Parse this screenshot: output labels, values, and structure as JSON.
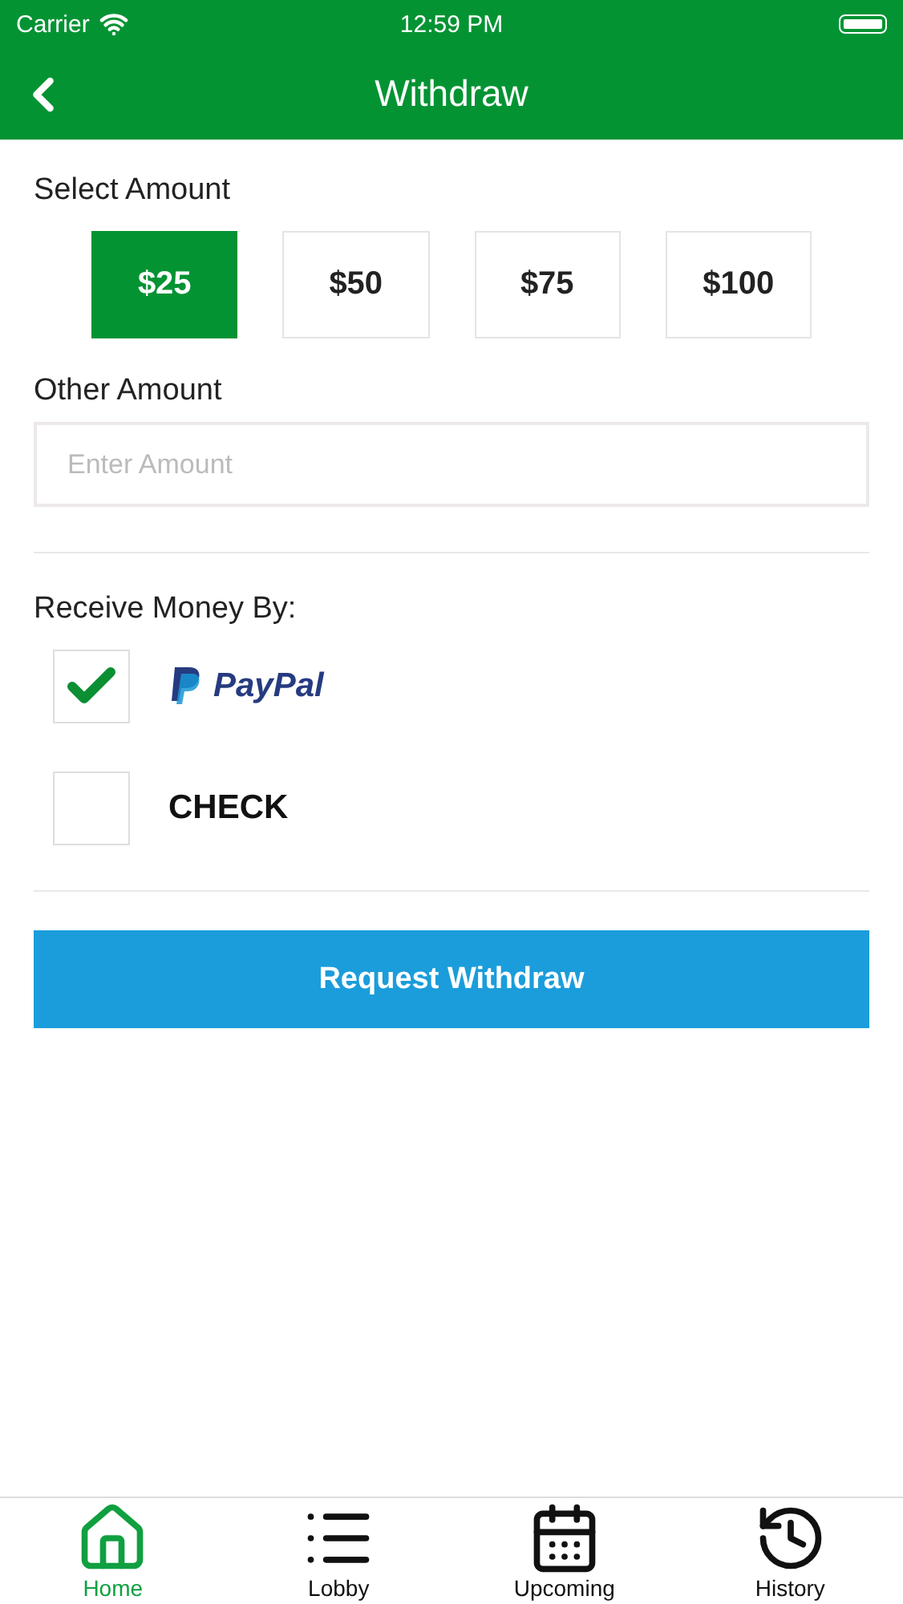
{
  "status_bar": {
    "carrier": "Carrier",
    "time": "12:59 PM"
  },
  "nav": {
    "title": "Withdraw"
  },
  "amount": {
    "label": "Select Amount",
    "options": [
      {
        "label": "$25",
        "selected": true
      },
      {
        "label": "$50",
        "selected": false
      },
      {
        "label": "$75",
        "selected": false
      },
      {
        "label": "$100",
        "selected": false
      }
    ]
  },
  "other_amount": {
    "label": "Other Amount",
    "placeholder": "Enter Amount"
  },
  "receive": {
    "label": "Receive Money By:",
    "methods": [
      {
        "kind": "logo",
        "label": "PayPal",
        "checked": true
      },
      {
        "kind": "text",
        "label": "CHECK",
        "checked": false
      }
    ]
  },
  "submit": {
    "label": "Request Withdraw"
  },
  "tab_bar": [
    {
      "label": "Home",
      "selected": true
    },
    {
      "label": "Lobby",
      "selected": false
    },
    {
      "label": "Upcoming",
      "selected": false
    },
    {
      "label": "History",
      "selected": false
    }
  ]
}
